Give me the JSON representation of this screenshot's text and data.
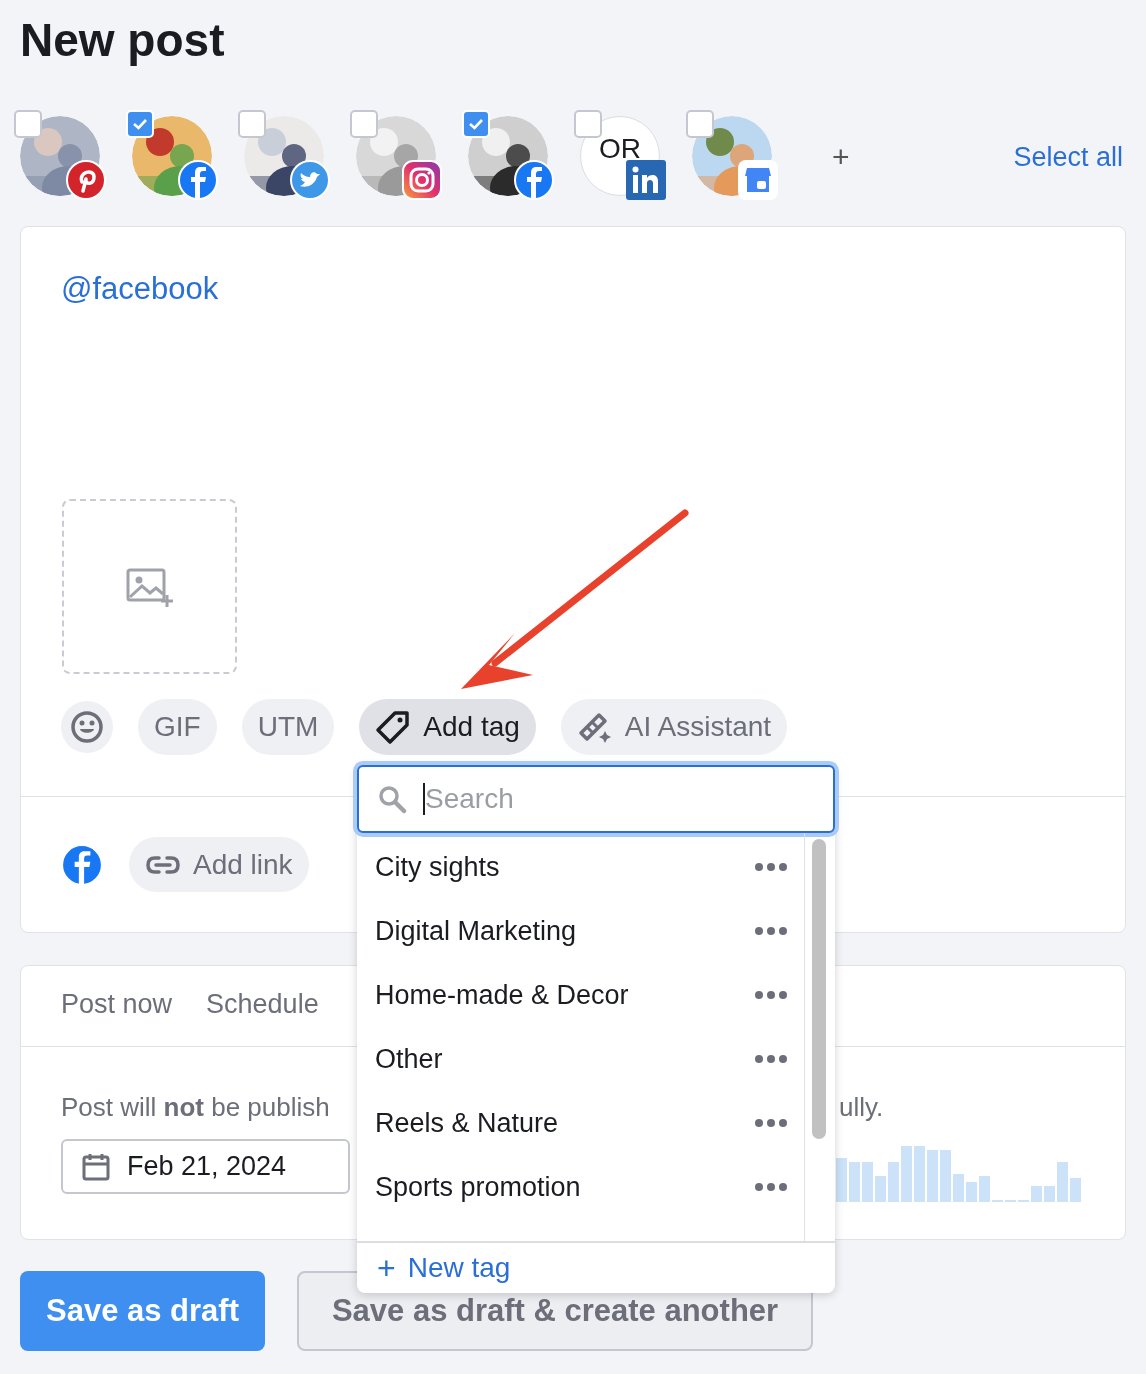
{
  "title": "New post",
  "accounts": [
    {
      "checked": false,
      "badge": {
        "kind": "pinterest"
      }
    },
    {
      "checked": true,
      "badge": {
        "kind": "facebook"
      }
    },
    {
      "checked": false,
      "badge": {
        "kind": "twitter"
      }
    },
    {
      "checked": false,
      "badge": {
        "kind": "instagram"
      }
    },
    {
      "checked": true,
      "badge": {
        "kind": "facebook"
      }
    },
    {
      "checked": false,
      "badge": {
        "kind": "linkedin"
      },
      "avatar": {
        "kind": "initials",
        "text": "OR"
      }
    },
    {
      "checked": false,
      "badge": {
        "kind": "google_business"
      }
    }
  ],
  "add_account": "+",
  "select_all": "Select all",
  "editor": {
    "text": "@facebook"
  },
  "toolbar": [
    {
      "kind": "emoji",
      "selected": false
    },
    {
      "kind": "text",
      "label": "GIF",
      "selected": false
    },
    {
      "kind": "text",
      "label": "UTM",
      "selected": false
    },
    {
      "kind": "tag",
      "label": "Add tag",
      "selected": true
    },
    {
      "kind": "ai",
      "label": "AI Assistant",
      "selected": false
    }
  ],
  "link_row": {
    "icon": {
      "kind": "facebook"
    },
    "add_link": "Add link"
  },
  "schedule": {
    "tabs": [
      {
        "label": "Post now",
        "selected": false
      },
      {
        "label": "Schedule",
        "selected": false
      }
    ],
    "notice_left": "Post will **not** be publish",
    "notice_right": "ully.",
    "date": "Feb 21, 2024"
  },
  "buttons": [
    {
      "kind": "primary",
      "label": "Save as draft"
    },
    {
      "kind": "secondary",
      "label": "Save as draft & create another"
    }
  ],
  "tag_menu": {
    "search": {
      "placeholder": "Search"
    },
    "tags": [
      "City sights",
      "Digital Marketing",
      "Home-made & Decor",
      "Other",
      "Reels & Nature",
      "Sports promotion"
    ],
    "new_tag_icon": "+",
    "new_tag": "New tag"
  }
}
